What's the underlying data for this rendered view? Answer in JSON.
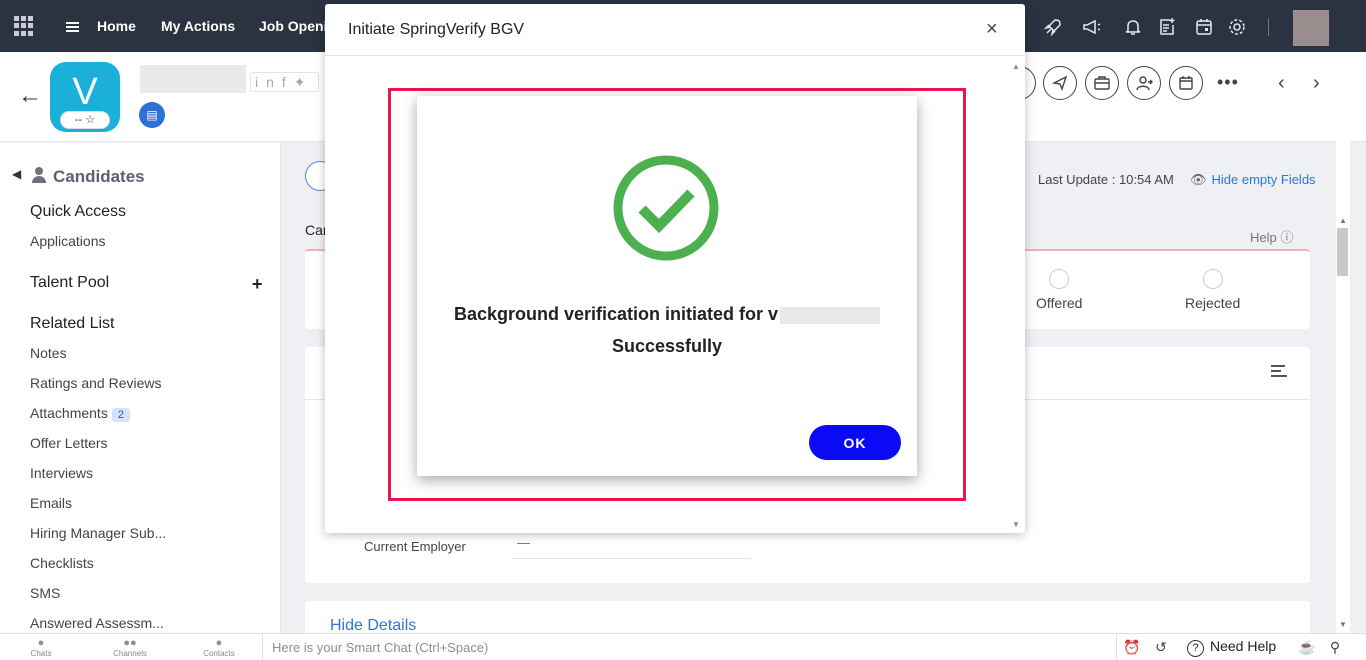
{
  "topnav": {
    "links": [
      "Home",
      "My Actions",
      "Job Openi"
    ]
  },
  "record": {
    "avatar_letter": "V",
    "rating_text": "-- ☆",
    "social_icons": "in f 🐦"
  },
  "sidebar": {
    "title": "Candidates",
    "quick_access": "Quick Access",
    "applications": "Applications",
    "talent_pool": "Talent Pool",
    "related_list": "Related List",
    "items": [
      {
        "label": "Notes"
      },
      {
        "label": "Ratings and Reviews"
      },
      {
        "label": "Attachments",
        "count": "2"
      },
      {
        "label": "Offer Letters"
      },
      {
        "label": "Interviews"
      },
      {
        "label": "Emails"
      },
      {
        "label": "Hiring Manager Sub..."
      },
      {
        "label": "Checklists"
      },
      {
        "label": "SMS"
      },
      {
        "label": "Answered Assessm..."
      }
    ]
  },
  "main": {
    "last_update": "Last Update : 10:54 AM",
    "hide_empty_fields": "Hide empty Fields",
    "section_label_partial": "Car",
    "help": "Help",
    "stages": [
      {
        "label": "Offered"
      },
      {
        "label": "Rejected"
      }
    ],
    "current_employer_label": "Current Employer",
    "current_employer_value": "—",
    "hide_details": "Hide Details"
  },
  "bottombar": {
    "tabs": [
      {
        "label": "Chats",
        "icon": "chat-icon"
      },
      {
        "label": "Channels",
        "icon": "channels-icon"
      },
      {
        "label": "Contacts",
        "icon": "contacts-icon"
      }
    ],
    "smart_chat_placeholder": "Here is your Smart Chat (Ctrl+Space)",
    "need_help": "Need Help"
  },
  "modal": {
    "title": "Initiate SpringVerify BGV",
    "close": "×",
    "success_line1": "Background verification initiated for v",
    "success_line2": "Successfully",
    "ok_label": "OK",
    "colors": {
      "check_green": "#4caf50",
      "ok_blue": "#0a0af5",
      "highlight_red": "#e8174d"
    }
  }
}
